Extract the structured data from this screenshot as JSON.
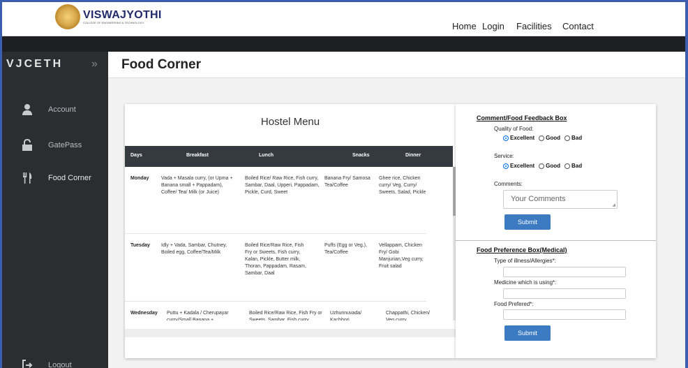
{
  "logo": {
    "name": "VISWAJYOTHI",
    "subtitle": "COLLEGE OF ENGINEERING & TECHNOLOGY"
  },
  "nav": {
    "items": [
      "Home",
      "Login",
      "Facilities",
      "Contact"
    ]
  },
  "sidebar": {
    "brand": "VJCETH",
    "toggle": "»",
    "items": [
      {
        "label": "Account",
        "icon": "user-icon"
      },
      {
        "label": "GatePass",
        "icon": "unlock-icon"
      },
      {
        "label": "Food Corner",
        "icon": "cutlery-icon"
      }
    ],
    "logout": {
      "label": "Logout",
      "icon": "logout-icon"
    }
  },
  "page_title": "Food Corner",
  "menu": {
    "title": "Hostel Menu",
    "columns": [
      "Days",
      "Breakfast",
      "Lunch",
      "Snacks",
      "Dinner"
    ],
    "rows": [
      {
        "day": "Monday",
        "breakfast": "Vada + Masala curry, (or Upma + Banana small + Pappadam), Coffee/ Tea/ Milk (or Juice)",
        "lunch": "Boiled Rice/ Raw Rice, Fish curry, Sambar, Daal, Upperi, Pappadam, Pickle, Curd, Sweet",
        "snacks": "Banana Fry/ Samosa Tea/Coffee",
        "dinner": "Ghee rice, Chicken curry/ Veg. Curry/ Sweets, Salad, Pickle"
      },
      {
        "day": "Tuesday",
        "breakfast": "Idly + Vada, Sambar, Chutney, Boiled egg, Coffee/Tea/Milk",
        "lunch": "Boiled Rice/Raw Rice, Fish Fry or Sweets, Fish curry, Kalan, Pickle, Butter milk, Thoran, Pappadam, Rasam, Sambar, Daal",
        "snacks": "Puffs (Egg or Veg.), Tea/Coffee",
        "dinner": "Vellappam, Chicken Fry/ Gobi Manjurian,Veg curry, Fruit salad"
      },
      {
        "day": "Wednesday",
        "breakfast": "Puttu + Kadala / Cherupayar curry/Small Banana +",
        "lunch": "Boiled Rice/Raw Rice, Fish Fry or Sweets, Sambar, Fish curry",
        "snacks": "Uzhunnuvada/ Kachhori",
        "dinner": "Chappathi, Chicken/ Veg curry"
      }
    ]
  },
  "feedback": {
    "heading": "Comment/Food Feedback Box",
    "quality_label": "Quality of Food:",
    "service_label": "Service:",
    "options": [
      "Excellent",
      "Good",
      "Bad"
    ],
    "quality_selected": "Excellent",
    "service_selected": "Excellent",
    "comments_label": "Comments:",
    "comments_placeholder": "Your Comments",
    "submit": "Submit"
  },
  "preference": {
    "heading": "Food Preference Box(Medical)",
    "illness_label": "Type of illness/Allergies*:",
    "medicine_label": "Medicine which is using*:",
    "food_label": "Food Prefered*:",
    "submit": "Submit"
  },
  "colors": {
    "accent": "#3c7bc1",
    "sidebar": "#2b2d30",
    "table_header": "#343a40",
    "frame": "#3b5fae"
  }
}
